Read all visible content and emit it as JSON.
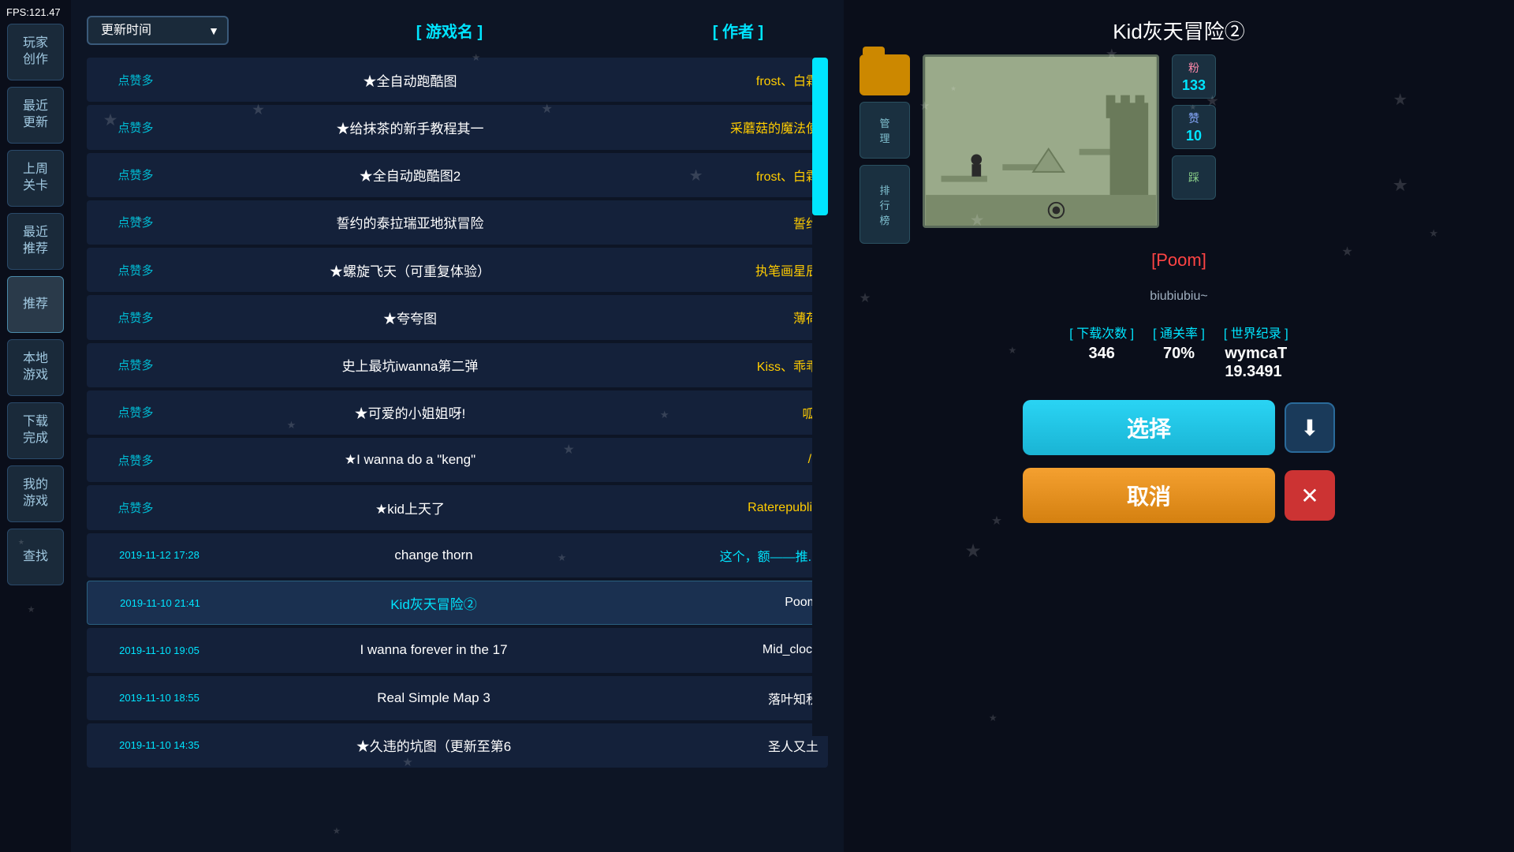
{
  "fps": "FPS:121.47",
  "sidebar": {
    "items": [
      {
        "label": "玩家\n创作",
        "id": "player-created"
      },
      {
        "label": "最近\n更新",
        "id": "recent-update"
      },
      {
        "label": "上周\n关卡",
        "id": "last-week"
      },
      {
        "label": "最近\n推荐",
        "id": "recent-recommend"
      },
      {
        "label": "推荐",
        "id": "recommend",
        "active": true
      },
      {
        "label": "本地\n游戏",
        "id": "local-games"
      },
      {
        "label": "下载\n完成",
        "id": "download-done"
      },
      {
        "label": "我的\n游戏",
        "id": "my-games"
      },
      {
        "label": "查找",
        "id": "search"
      }
    ]
  },
  "topbar": {
    "sort_label": "更新时间",
    "col_name": "[ 游戏名 ]",
    "col_author": "[ 作者 ]"
  },
  "game_list": [
    {
      "tag": "点赞多",
      "name": "★全自动跑酷图",
      "author": "frost、白霜",
      "author_color": "yellow",
      "selected": false
    },
    {
      "tag": "点赞多",
      "name": "★给抹茶的新手教程其一",
      "author": "采蘑菇的魔法使",
      "author_color": "yellow",
      "selected": false
    },
    {
      "tag": "点赞多",
      "name": "★全自动跑酷图2",
      "author": "frost、白霜",
      "author_color": "yellow",
      "selected": false
    },
    {
      "tag": "点赞多",
      "name": "誓约的泰拉瑞亚地狱冒险",
      "author": "誓约",
      "author_color": "yellow",
      "selected": false
    },
    {
      "tag": "点赞多",
      "name": "★螺旋飞天（可重复体验）",
      "author": "执笔画星辰",
      "author_color": "yellow",
      "selected": false
    },
    {
      "tag": "点赞多",
      "name": "★夸夸图",
      "author": "薄荷",
      "author_color": "yellow",
      "selected": false
    },
    {
      "tag": "点赞多",
      "name": "史上最坑iwanna第二弹",
      "author": "Kiss、乖乖",
      "author_color": "yellow",
      "selected": false
    },
    {
      "tag": "点赞多",
      "name": "★可爱的小姐姐呀!",
      "author": "呱!",
      "author_color": "yellow",
      "selected": false
    },
    {
      "tag": "点赞多",
      "name": "★I wanna do a \"keng\"",
      "author": "/ /",
      "author_color": "yellow",
      "selected": false
    },
    {
      "tag": "点赞多",
      "name": "★kid上天了",
      "author": "Raterepublik",
      "author_color": "yellow",
      "selected": false
    },
    {
      "tag": "2019-11-12 17:28",
      "name": "change thorn",
      "author": "这个，额——推...",
      "author_color": "cyan",
      "selected": false
    },
    {
      "tag": "2019-11-10 21:41",
      "name": "Kid灰天冒险②",
      "author": "Poom",
      "author_color": "white",
      "selected": true
    },
    {
      "tag": "2019-11-10 19:05",
      "name": "I wanna forever in the 17",
      "author": "Mid_clock",
      "author_color": "white",
      "selected": false
    },
    {
      "tag": "2019-11-10 18:55",
      "name": "Real Simple Map 3",
      "author": "落叶知秋",
      "author_color": "white",
      "selected": false
    },
    {
      "tag": "2019-11-10 14:35",
      "name": "★久违的坑图（更新至第6",
      "author": "圣人又土",
      "author_color": "white",
      "selected": false
    }
  ],
  "right_panel": {
    "title": "Kid灰天冒险②",
    "author": "[Poom]",
    "description": "biubiubiu~",
    "pink_count": "133",
    "zan_count": "10",
    "download_count": "346",
    "pass_rate": "70%",
    "world_record": "wymcaT\n19.3491",
    "labels": {
      "download_count": "[ 下载次数 ]",
      "pass_rate": "[ 通关率 ]",
      "world_record": "[ 世界纪录 ]",
      "pink": "粉",
      "zan": "赞",
      "cai": "踩"
    },
    "buttons": {
      "select": "选择",
      "cancel": "取消"
    }
  }
}
